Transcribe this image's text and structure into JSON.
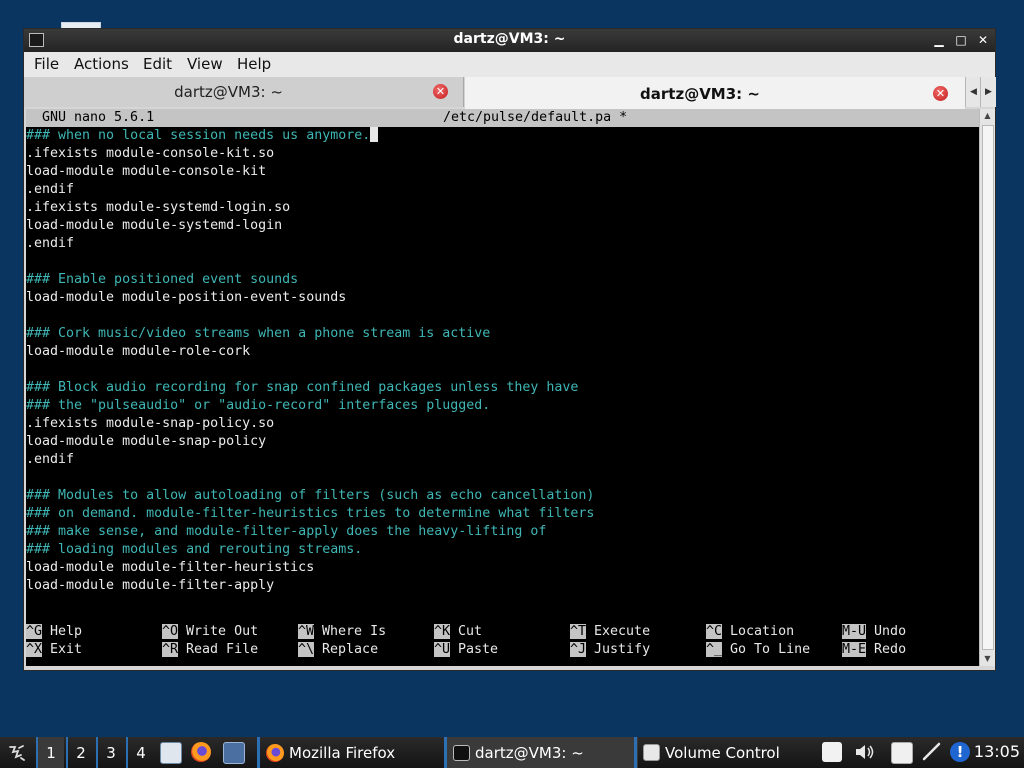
{
  "window": {
    "title": "dartz@VM3: ~"
  },
  "menubar": {
    "items": [
      "File",
      "Actions",
      "Edit",
      "View",
      "Help"
    ]
  },
  "tabs": [
    {
      "label": "dartz@VM3: ~",
      "active": false
    },
    {
      "label": "dartz@VM3: ~",
      "active": true
    }
  ],
  "nano": {
    "version": "GNU nano 5.6.1",
    "filename": "/etc/pulse/default.pa *"
  },
  "buffer_lines": [
    {
      "text": "### when no local session needs us anymore.",
      "comment": true,
      "cursor": true
    },
    {
      "text": ".ifexists module-console-kit.so",
      "comment": false
    },
    {
      "text": "load-module module-console-kit",
      "comment": false
    },
    {
      "text": ".endif",
      "comment": false
    },
    {
      "text": ".ifexists module-systemd-login.so",
      "comment": false
    },
    {
      "text": "load-module module-systemd-login",
      "comment": false
    },
    {
      "text": ".endif",
      "comment": false
    },
    {
      "text": "",
      "comment": false
    },
    {
      "text": "### Enable positioned event sounds",
      "comment": true
    },
    {
      "text": "load-module module-position-event-sounds",
      "comment": false
    },
    {
      "text": "",
      "comment": false
    },
    {
      "text": "### Cork music/video streams when a phone stream is active",
      "comment": true
    },
    {
      "text": "load-module module-role-cork",
      "comment": false
    },
    {
      "text": "",
      "comment": false
    },
    {
      "text": "### Block audio recording for snap confined packages unless they have",
      "comment": true
    },
    {
      "text": "### the \"pulseaudio\" or \"audio-record\" interfaces plugged.",
      "comment": true
    },
    {
      "text": ".ifexists module-snap-policy.so",
      "comment": false
    },
    {
      "text": "load-module module-snap-policy",
      "comment": false
    },
    {
      "text": ".endif",
      "comment": false
    },
    {
      "text": "",
      "comment": false
    },
    {
      "text": "### Modules to allow autoloading of filters (such as echo cancellation)",
      "comment": true
    },
    {
      "text": "### on demand. module-filter-heuristics tries to determine what filters",
      "comment": true
    },
    {
      "text": "### make sense, and module-filter-apply does the heavy-lifting of",
      "comment": true
    },
    {
      "text": "### loading modules and rerouting streams.",
      "comment": true
    },
    {
      "text": "load-module module-filter-heuristics",
      "comment": false
    },
    {
      "text": "load-module module-filter-apply",
      "comment": false
    }
  ],
  "shortcuts": [
    [
      {
        "key": "^G",
        "label": "Help"
      },
      {
        "key": "^O",
        "label": "Write Out"
      },
      {
        "key": "^W",
        "label": "Where Is"
      },
      {
        "key": "^K",
        "label": "Cut"
      },
      {
        "key": "^T",
        "label": "Execute"
      },
      {
        "key": "^C",
        "label": "Location"
      },
      {
        "key": "M-U",
        "label": "Undo"
      }
    ],
    [
      {
        "key": "^X",
        "label": "Exit"
      },
      {
        "key": "^R",
        "label": "Read File"
      },
      {
        "key": "^\\",
        "label": "Replace"
      },
      {
        "key": "^U",
        "label": "Paste"
      },
      {
        "key": "^J",
        "label": "Justify"
      },
      {
        "key": "^_",
        "label": "Go To Line"
      },
      {
        "key": "M-E",
        "label": "Redo"
      }
    ]
  ],
  "taskbar": {
    "workspaces": [
      "1",
      "2",
      "3",
      "4"
    ],
    "current_workspace": "1",
    "tasks": [
      {
        "label": "Mozilla Firefox",
        "icon": "firefox-icon"
      },
      {
        "label": "dartz@VM3: ~",
        "icon": "terminal-icon"
      },
      {
        "label": "Volume Control",
        "icon": "volume-control-icon"
      }
    ],
    "clock": "13:05"
  },
  "colors": {
    "desktop": "#0b3561",
    "comment_text": "#3fb6b4",
    "normal_text": "#ececec",
    "accent": "#2c6fb3"
  }
}
